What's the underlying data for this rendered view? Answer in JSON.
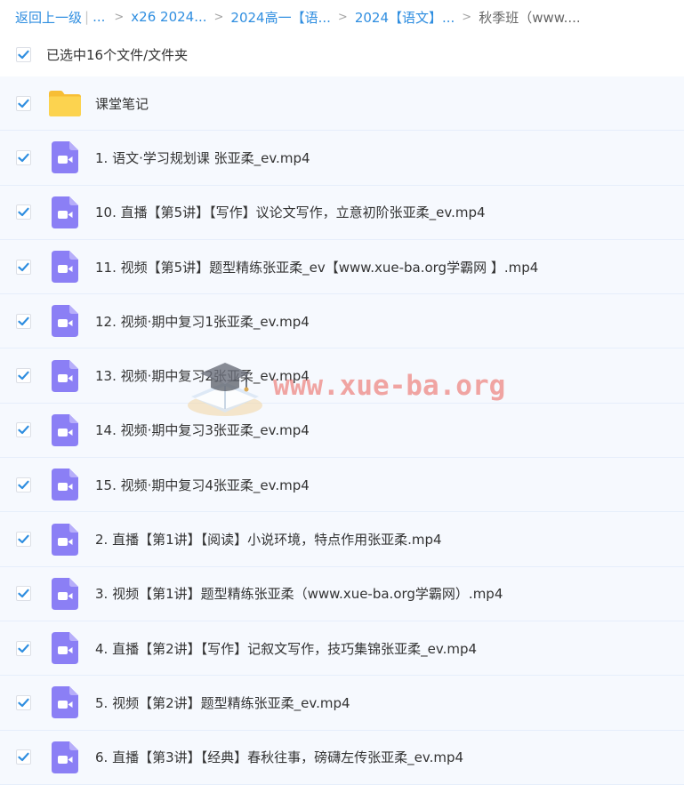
{
  "breadcrumb": {
    "back_label": "返回上一级",
    "divider": "|",
    "ellipsis": "...",
    "separator": ">",
    "items": [
      "x26 2024...",
      "2024高一【语...",
      "2024【语文】...",
      "秋季班（www...."
    ]
  },
  "selection": {
    "label": "已选中16个文件/文件夹",
    "checked": true
  },
  "colors": {
    "accent": "#2f8ee0",
    "folder": "#fcd34f",
    "video_icon": "#8b7ff5",
    "row_background": "#f6f9fe",
    "watermark": "#eb5f55"
  },
  "files": [
    {
      "name": "课堂笔记",
      "type": "folder",
      "icon": "folder-icon",
      "checked": true
    },
    {
      "name": "1. 语文·学习规划课 张亚柔_ev.mp4",
      "type": "video",
      "icon": "video-icon",
      "checked": true
    },
    {
      "name": "10. 直播【第5讲】【写作】议论文写作，立意初阶张亚柔_ev.mp4",
      "type": "video",
      "icon": "video-icon",
      "checked": true
    },
    {
      "name": "11. 视频【第5讲】题型精练张亚柔_ev【www.xue-ba.org学霸网 】.mp4",
      "type": "video",
      "icon": "video-icon",
      "checked": true
    },
    {
      "name": "12. 视频·期中复习1张亚柔_ev.mp4",
      "type": "video",
      "icon": "video-icon",
      "checked": true
    },
    {
      "name": "13. 视频·期中复习2张亚柔_ev.mp4",
      "type": "video",
      "icon": "video-icon",
      "checked": true
    },
    {
      "name": "14. 视频·期中复习3张亚柔_ev.mp4",
      "type": "video",
      "icon": "video-icon",
      "checked": true
    },
    {
      "name": "15. 视频·期中复习4张亚柔_ev.mp4",
      "type": "video",
      "icon": "video-icon",
      "checked": true
    },
    {
      "name": "2. 直播【第1讲】【阅读】小说环境，特点作用张亚柔.mp4",
      "type": "video",
      "icon": "video-icon",
      "checked": true
    },
    {
      "name": "3. 视频【第1讲】题型精练张亚柔（www.xue-ba.org学霸网）.mp4",
      "type": "video",
      "icon": "video-icon",
      "checked": true
    },
    {
      "name": "4. 直播【第2讲】【写作】记叙文写作，技巧集锦张亚柔_ev.mp4",
      "type": "video",
      "icon": "video-icon",
      "checked": true
    },
    {
      "name": "5. 视频【第2讲】题型精练张亚柔_ev.mp4",
      "type": "video",
      "icon": "video-icon",
      "checked": true
    },
    {
      "name": "6. 直播【第3讲】【经典】春秋往事，磅礴左传张亚柔_ev.mp4",
      "type": "video",
      "icon": "video-icon",
      "checked": true
    }
  ],
  "watermark": {
    "text": "www.xue-ba.org",
    "icon": "graduation-cap-book-icon"
  }
}
